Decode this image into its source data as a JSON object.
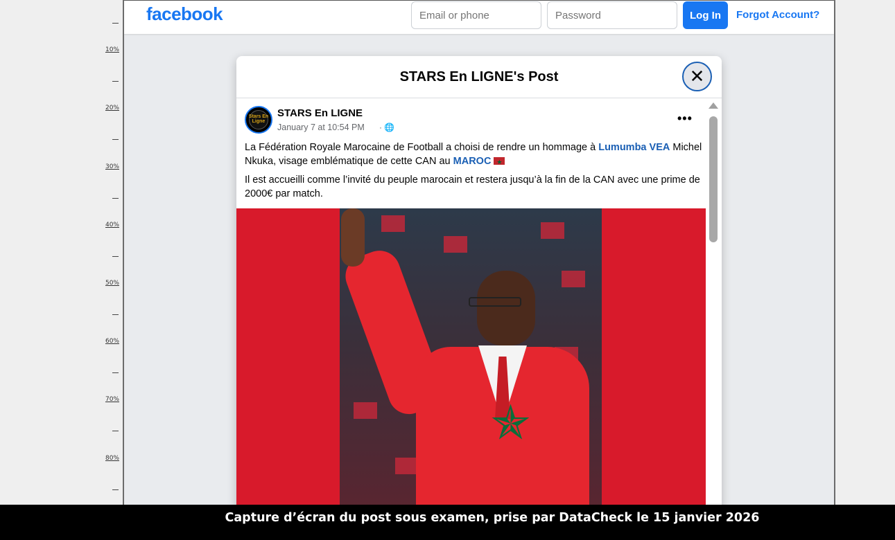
{
  "ruler": {
    "labels": [
      "10%",
      "20%",
      "30%",
      "40%",
      "50%",
      "60%",
      "70%",
      "80%"
    ]
  },
  "topbar": {
    "logo": "facebook",
    "email_placeholder": "Email or phone",
    "password_placeholder": "Password",
    "login_label": "Log In",
    "forgot_label": "Forgot Account?"
  },
  "dialog": {
    "title": "STARS En LIGNE's Post",
    "close_icon": "close-icon"
  },
  "post": {
    "author": "STARS En LIGNE",
    "avatar_text": "Stars En Ligne",
    "timestamp": "January 7 at 10:54 PM",
    "separator": "·",
    "audience_icon": "globe-icon",
    "more_icon": "more-options-icon",
    "paragraph1_before": "La Fédération Royale Marocaine de Football a choisi de rendre un hommage à ",
    "paragraph1_link1": "Lumumba VEA",
    "paragraph1_middle": " Michel Nkuka, visage emblématique de cette CAN au ",
    "paragraph1_link2": "MAROC",
    "paragraph2": "Il est accueilli comme l’invité du peuple marocain et restera jusqu’à la fin de la CAN avec une prime de 2000€ par match."
  },
  "colors": {
    "brand": "#1877f2",
    "link": "#1a5fb4",
    "image_bg": "#d81a2b"
  },
  "caption": {
    "text": "Capture d’écran du post sous examen, prise par DataCheck le 15 janvier 2026"
  }
}
